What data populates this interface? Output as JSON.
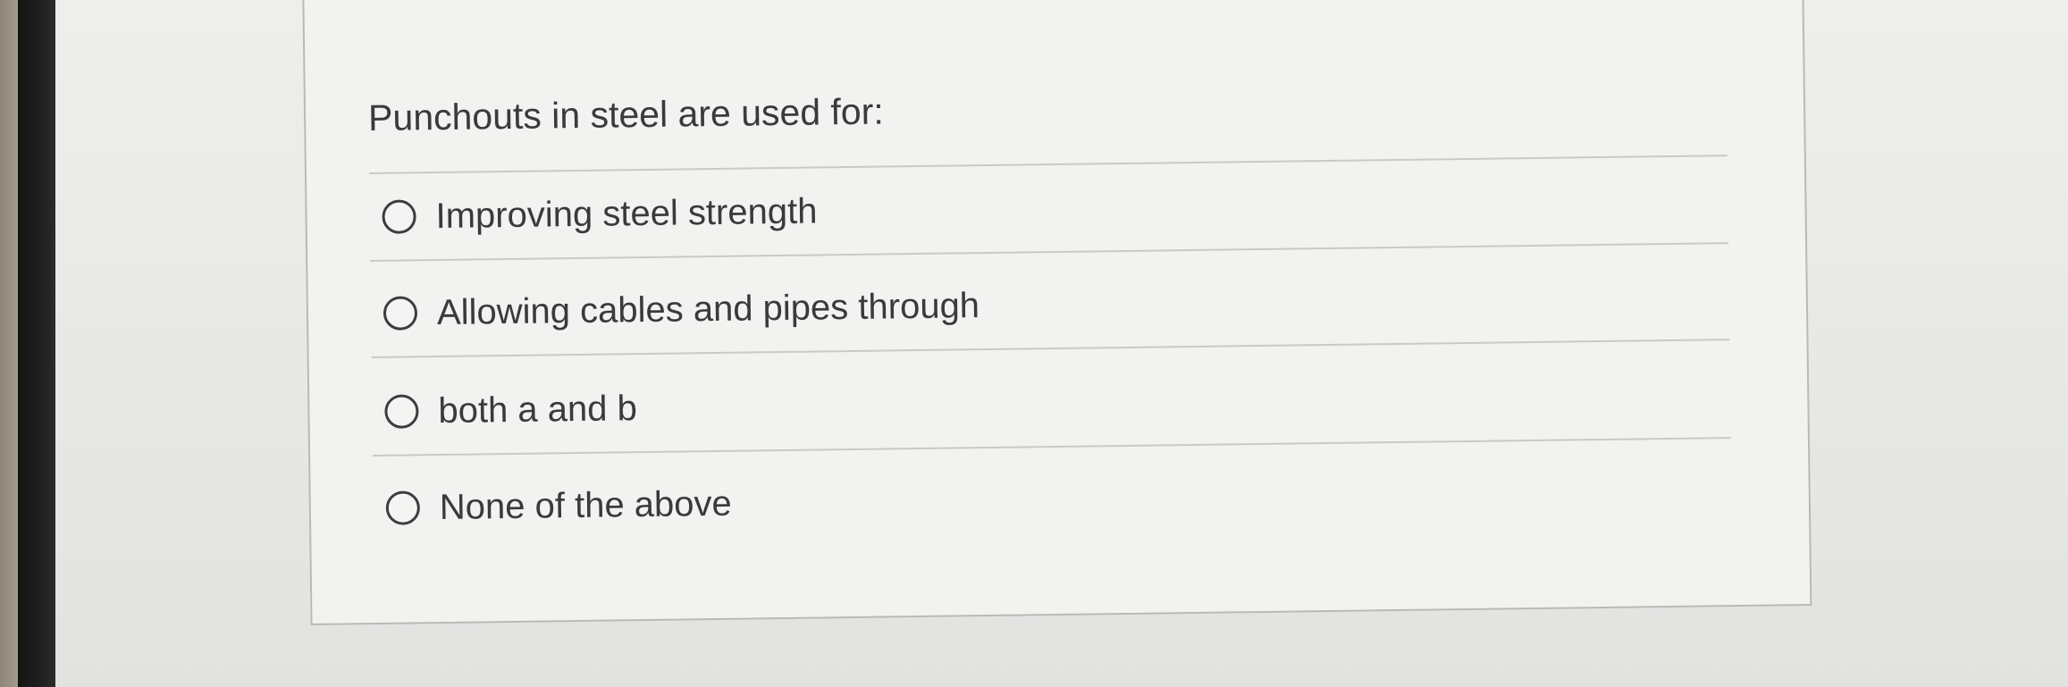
{
  "question": {
    "text": "Punchouts in steel are used for:"
  },
  "options": [
    {
      "label": "Improving steel strength",
      "selected": false
    },
    {
      "label": "Allowing cables and pipes through",
      "selected": false
    },
    {
      "label": "both a and b",
      "selected": false
    },
    {
      "label": "None of the above",
      "selected": false
    }
  ]
}
